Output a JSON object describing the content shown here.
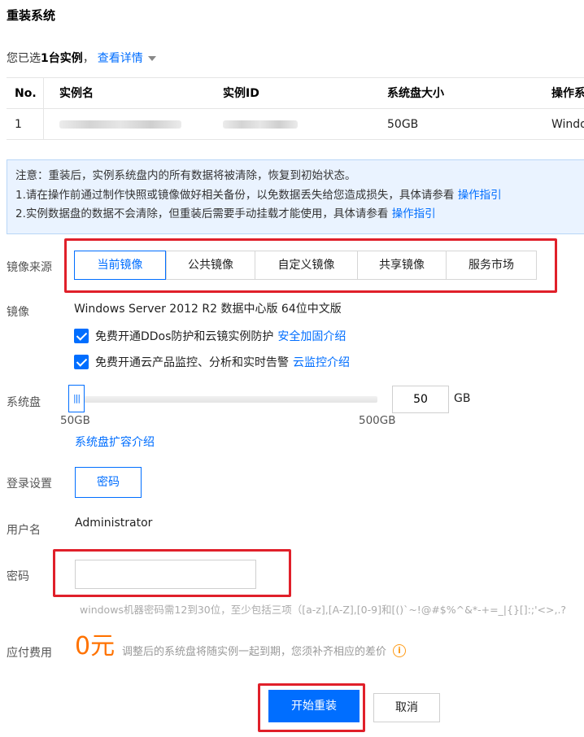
{
  "title": "重装系统",
  "selection": {
    "prefix": "您已选",
    "count_text": "1台实例",
    "suffix": "，",
    "details_link": "查看详情"
  },
  "table": {
    "headers": [
      "No.",
      "实例名",
      "实例ID",
      "系统盘大小",
      "操作系"
    ],
    "rows": [
      {
        "no": "1",
        "disk": "50GB",
        "os": "Windo"
      }
    ]
  },
  "notice": {
    "line1": "注意：重装后，实例系统盘内的所有数据将被清除，恢复到初始状态。",
    "line2": "1.请在操作前通过制作快照或镜像做好相关备份，以免数据丢失给您造成损失，具体请参看",
    "line2_link": "操作指引",
    "line3": "2.实例数据盘的数据不会清除，但重装后需要手动挂载才能使用，具体请参看",
    "line3_link": "操作指引"
  },
  "image_source": {
    "label": "镜像来源",
    "tabs": [
      "当前镜像",
      "公共镜像",
      "自定义镜像",
      "共享镜像",
      "服务市场"
    ],
    "active_index": 0
  },
  "image": {
    "label": "镜像",
    "value": "Windows Server 2012 R2 数据中心版 64位中文版"
  },
  "options": {
    "ddos_label": "免费开通DDos防护和云镜实例防护",
    "ddos_link": "安全加固介绍",
    "monitor_label": "免费开通云产品监控、分析和实时告警",
    "monitor_link": "云监控介绍"
  },
  "system_disk": {
    "label": "系统盘",
    "value": "50",
    "unit": "GB",
    "min_label": "50GB",
    "max_label": "500GB",
    "thumb_glyph": "|||",
    "expand_link": "系统盘扩容介绍",
    "fill_fraction": 0
  },
  "login": {
    "label": "登录设置",
    "mode_button": "密码"
  },
  "username": {
    "label": "用户名",
    "value": "Administrator"
  },
  "password": {
    "label": "密码",
    "value": "",
    "placeholder": "",
    "hint": "windows机器密码需12到30位，至少包括三项（[a-z],[A-Z],[0-9]和[()`~!@#$%^&*-+=_|{}[]:;'<>,.?"
  },
  "cost": {
    "label": "应付费用",
    "amount": "0元",
    "note": "调整后的系统盘将随实例一起到期，您须补齐相应的差价",
    "info_glyph": "i"
  },
  "actions": {
    "start_label": "开始重装",
    "cancel_label": "取消"
  },
  "colors": {
    "accent": "#006eff",
    "highlight": "#e0202a",
    "price": "#ff7200",
    "notice_bg": "#eaf3ff"
  }
}
